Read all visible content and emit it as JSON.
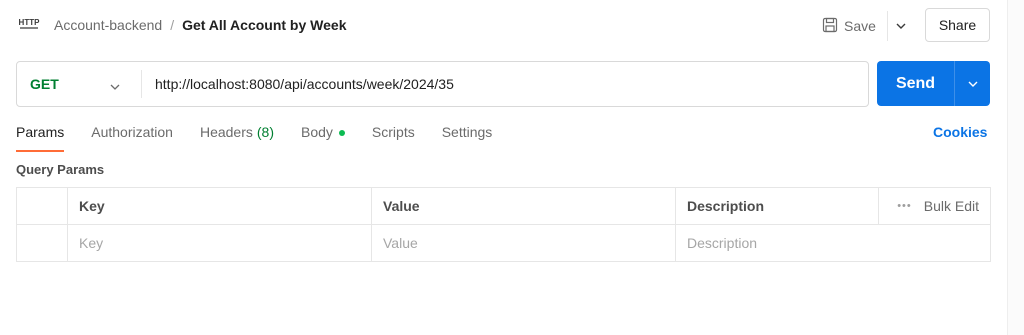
{
  "header": {
    "icon": "http-file-icon",
    "icon_text": "HTTP",
    "collection": "Account-backend",
    "separator": "/",
    "request_name": "Get All Account by Week",
    "save_label": "Save",
    "share_label": "Share"
  },
  "request": {
    "method": "GET",
    "method_color": "#007f31",
    "url": "http://localhost:8080/api/accounts/week/2024/35",
    "send_label": "Send",
    "send_color": "#0b74e5"
  },
  "tabs": [
    {
      "label": "Params",
      "active": true
    },
    {
      "label": "Authorization"
    },
    {
      "label": "Headers",
      "count": "(8)"
    },
    {
      "label": "Body",
      "indicator": "dot"
    },
    {
      "label": "Scripts"
    },
    {
      "label": "Settings"
    }
  ],
  "cookies_label": "Cookies",
  "query_params": {
    "title": "Query Params",
    "columns": [
      "Key",
      "Value",
      "Description"
    ],
    "bulk_edit_label": "Bulk Edit",
    "placeholders": {
      "key": "Key",
      "value": "Value",
      "description": "Description"
    }
  },
  "accent_colors": {
    "active_tab": "#ff6c37",
    "body_dot": "#0cbb52"
  }
}
